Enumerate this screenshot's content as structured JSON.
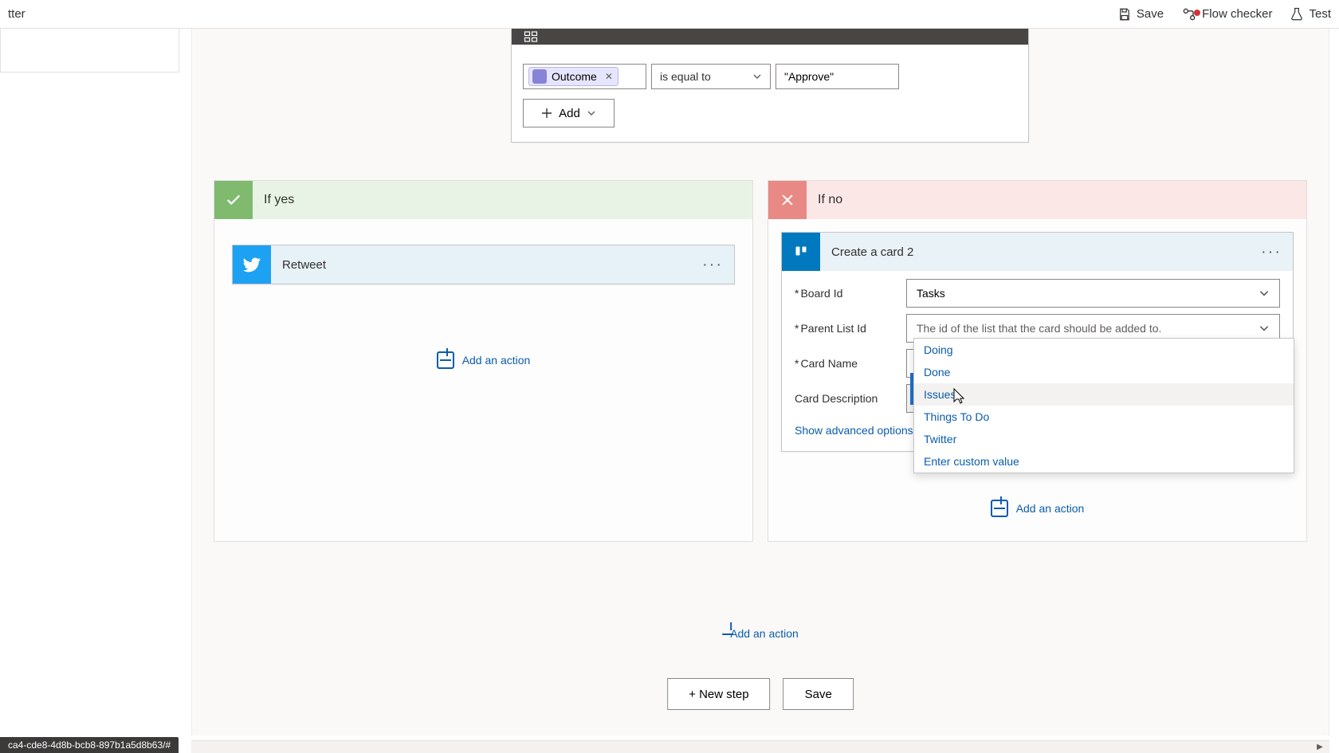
{
  "topbar": {
    "breadcrumb_fragment": "tter",
    "save": "Save",
    "flow_checker": "Flow checker",
    "test": "Test"
  },
  "condition": {
    "token_label": "Outcome",
    "operator": "is equal to",
    "value": "\"Approve\"",
    "add_label": "Add"
  },
  "branches": {
    "yes_label": "If yes",
    "no_label": "If no"
  },
  "yes_action": {
    "title": "Retweet",
    "add_action": "Add an action"
  },
  "no_action": {
    "title": "Create a card 2",
    "fields": {
      "board_id_label": "Board Id",
      "board_id_value": "Tasks",
      "parent_list_label": "Parent List Id",
      "parent_list_placeholder": "The id of the list that the card should be added to.",
      "card_name_label": "Card Name",
      "card_desc_label": "Card Description"
    },
    "show_advanced": "Show advanced options",
    "add_action": "Add an action"
  },
  "dropdown": {
    "items": [
      "Doing",
      "Done",
      "Issues",
      "Things To Do",
      "Twitter",
      "Enter custom value"
    ],
    "highlighted_index": 2
  },
  "bottom_add": "Add an action",
  "footer": {
    "new_step": "+ New step",
    "save": "Save"
  },
  "status_text": "ca4-cde8-4d8b-bcb8-897b1a5d8b63/#"
}
